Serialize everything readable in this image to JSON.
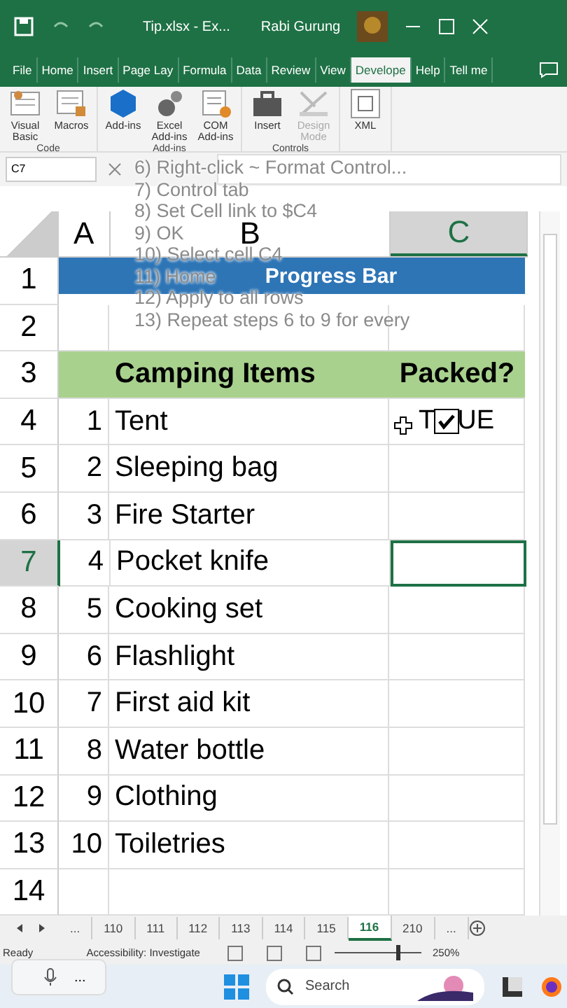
{
  "title_bar": {
    "file": "Tip.xlsx  -  Ex...",
    "user": "Rabi Gurung"
  },
  "menu_tabs": [
    {
      "label": "File",
      "selected": false
    },
    {
      "label": "Home",
      "selected": false
    },
    {
      "label": "Insert",
      "selected": false
    },
    {
      "label": "Page Lay",
      "selected": false
    },
    {
      "label": "Formula",
      "selected": false
    },
    {
      "label": "Data",
      "selected": false
    },
    {
      "label": "Review",
      "selected": false
    },
    {
      "label": "View",
      "selected": false
    },
    {
      "label": "Develope",
      "selected": true
    },
    {
      "label": "Help",
      "selected": false
    },
    {
      "label": "Tell me",
      "selected": false
    }
  ],
  "ribbon_groups": [
    {
      "name": "Code",
      "buttons": [
        {
          "label": "Visual Basic",
          "kind": "vba",
          "disabled": false
        },
        {
          "label": "Macros",
          "kind": "macros",
          "disabled": false
        }
      ]
    },
    {
      "name": "Add-ins",
      "buttons": [
        {
          "label": "Add-ins",
          "kind": "addins",
          "disabled": false
        },
        {
          "label": "Excel Add-ins",
          "kind": "gear",
          "disabled": false
        },
        {
          "label": "COM Add-ins",
          "kind": "com",
          "disabled": false
        }
      ]
    },
    {
      "name": "Controls",
      "buttons": [
        {
          "label": "Insert",
          "kind": "toolbox",
          "disabled": false
        },
        {
          "label": "Design Mode",
          "kind": "design",
          "disabled": true
        }
      ]
    },
    {
      "buttons": [
        {
          "label": "XML",
          "kind": "xml",
          "disabled": false
        }
      ]
    }
  ],
  "name_box": "C7",
  "columns": [
    {
      "label": "A",
      "selected": false
    },
    {
      "label": "B",
      "selected": false
    },
    {
      "label": "C",
      "selected": true
    }
  ],
  "rows": [
    {
      "header": "1",
      "kind": "title",
      "text": "Progress Bar",
      "selected": false
    },
    {
      "header": "2",
      "kind": "blank",
      "selected": false
    },
    {
      "header": "3",
      "kind": "heading",
      "cells": [
        "Camping Items",
        "Packed?"
      ],
      "selected": false
    },
    {
      "header": "4",
      "kind": "item",
      "number": "1",
      "name": "Tent",
      "value": "T",
      "value_rest": "UE",
      "checked": true,
      "selected": false
    },
    {
      "header": "5",
      "kind": "item",
      "number": "2",
      "name": "Sleeping bag",
      "selected": false
    },
    {
      "header": "6",
      "kind": "item",
      "number": "3",
      "name": "Fire Starter",
      "selected": false
    },
    {
      "header": "7",
      "kind": "item",
      "number": "4",
      "name": "Pocket knife",
      "selected": true
    },
    {
      "header": "8",
      "kind": "item",
      "number": "5",
      "name": "Cooking set",
      "selected": false
    },
    {
      "header": "9",
      "kind": "item",
      "number": "6",
      "name": "Flashlight",
      "selected": false
    },
    {
      "header": "10",
      "kind": "item",
      "number": "7",
      "name": "First aid kit",
      "selected": false
    },
    {
      "header": "11",
      "kind": "item",
      "number": "8",
      "name": "Water bottle",
      "selected": false
    },
    {
      "header": "12",
      "kind": "item",
      "number": "9",
      "name": "Clothing",
      "selected": false
    },
    {
      "header": "13",
      "kind": "item",
      "number": "10",
      "name": "Toiletries",
      "selected": false
    },
    {
      "header": "14",
      "kind": "blank",
      "selected": false
    }
  ],
  "steps": [
    "6) Right-click ~ Format Control...",
    "7) Control tab",
    "8) Set Cell link to $C4",
    "9) OK",
    "10) Select cell C4",
    "11) Home",
    "12) Apply to all rows",
    "13) Repeat steps 6 to 9 for every"
  ],
  "sheet_tabs": [
    {
      "label": "...",
      "selected": false
    },
    {
      "label": "110",
      "selected": false
    },
    {
      "label": "111",
      "selected": false
    },
    {
      "label": "112",
      "selected": false
    },
    {
      "label": "113",
      "selected": false
    },
    {
      "label": "114",
      "selected": false
    },
    {
      "label": "115",
      "selected": false
    },
    {
      "label": "116",
      "selected": true
    },
    {
      "label": "210",
      "selected": false
    },
    {
      "label": "...",
      "selected": false
    }
  ],
  "status_bar": {
    "mode": "Ready",
    "accessibility": "Accessibility: Investigate",
    "zoom": {
      "level": 0.72
    },
    "zoom_text": "250%"
  },
  "voice_menu": "...",
  "taskbar": {
    "search_placeholder": "Search"
  }
}
